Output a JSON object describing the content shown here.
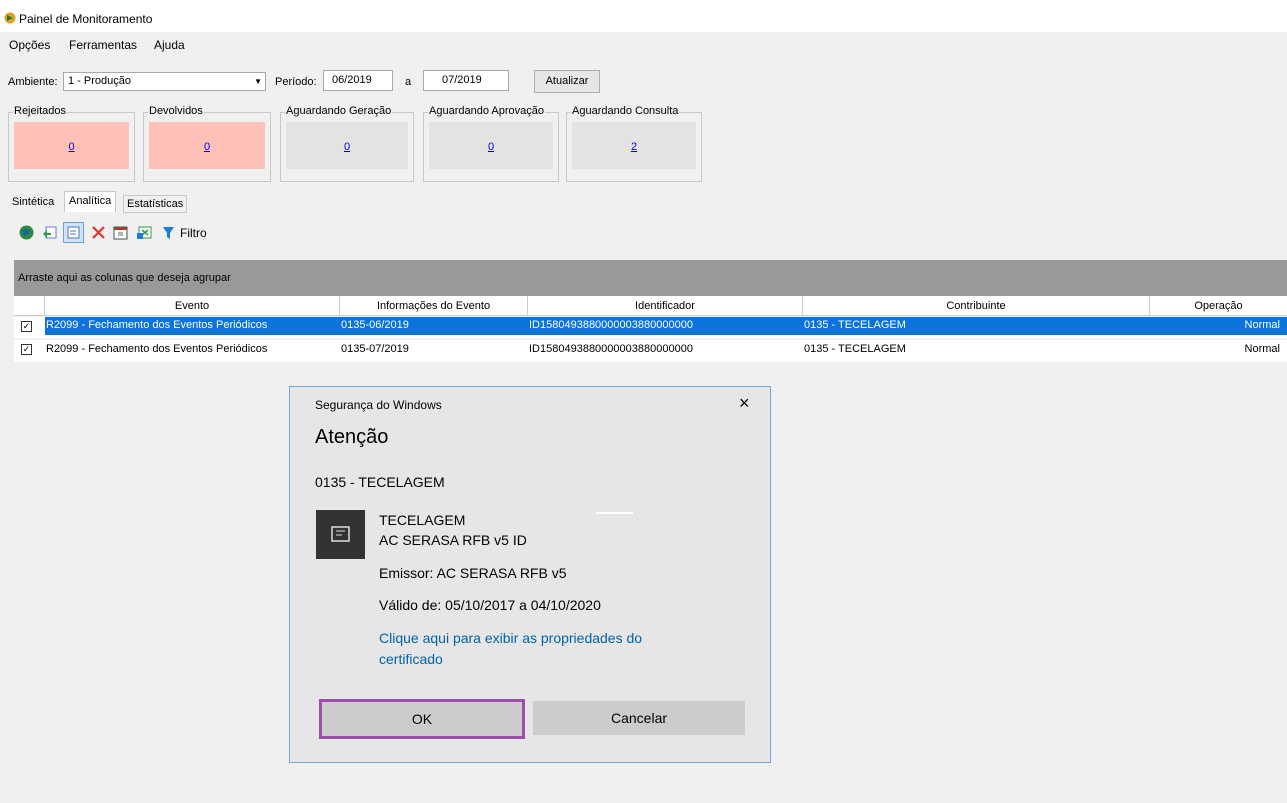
{
  "window": {
    "title": "Painel de Monitoramento"
  },
  "menu": [
    "Opções",
    "Ferramentas",
    "Ajuda"
  ],
  "filters": {
    "ambiente_label": "Ambiente:",
    "ambiente_value": "1 - Produção",
    "periodo_label": "Período:",
    "periodo_from": "06/2019",
    "periodo_sep": "a",
    "periodo_to": "07/2019",
    "update_button": "Atualizar"
  },
  "status_boxes": [
    {
      "title": "Rejeitados",
      "count": "0",
      "color": "#ffc0b8"
    },
    {
      "title": "Devolvidos",
      "count": "0",
      "color": "#ffc0b8"
    },
    {
      "title": "Aguardando Geração",
      "count": "0",
      "color": "#e3e3e3"
    },
    {
      "title": "Aguardando Aprovação",
      "count": "0",
      "color": "#e3e3e3"
    },
    {
      "title": "Aguardando Consulta",
      "count": "2",
      "color": "#e3e3e3"
    }
  ],
  "tabs": [
    "Sintética",
    "Analítica",
    "Estatísticas"
  ],
  "active_tab": "Analítica",
  "toolbar": {
    "icons": [
      "globe-icon",
      "refresh-icon",
      "select-icon",
      "delete-icon",
      "calendar-icon",
      "export-icon",
      "filter-icon"
    ],
    "filter_label": "Filtro"
  },
  "grid": {
    "group_hint": "Arraste aqui as colunas que deseja agrupar",
    "columns": [
      "Evento",
      "Informações do Evento",
      "Identificador",
      "Contribuinte",
      "Operação"
    ],
    "rows": [
      {
        "checked": true,
        "selected": true,
        "evento": "R2099 - Fechamento dos Eventos Periódicos",
        "info": "0135-06/2019",
        "id": "ID1580493880000003880000000",
        "contribuinte": "0135 - TECELAGEM",
        "operacao": "Normal"
      },
      {
        "checked": true,
        "selected": false,
        "evento": "R2099 - Fechamento dos Eventos Periódicos",
        "info": "0135-07/2019",
        "id": "ID1580493880000003880000000",
        "contribuinte": "0135 - TECELAGEM",
        "operacao": "Normal"
      }
    ]
  },
  "dialog": {
    "caption": "Segurança do Windows",
    "heading": "Atenção",
    "subject": "0135 - TECELAGEM",
    "cert_name": "TECELAGEM",
    "cert_ca": "AC SERASA RFB v5 ID",
    "issuer": "Emissor: AC SERASA RFB v5",
    "validity": "Válido de: 05/10/2017 a 04/10/2020",
    "link_line1": "Clique aqui para exibir as propriedades do",
    "link_line2": "certificado",
    "ok": "OK",
    "cancel": "Cancelar",
    "close_glyph": "×"
  },
  "colors": {
    "selected_row": "#0a74da",
    "link": "#0063b1",
    "ok_border": "#9b4fa8"
  }
}
